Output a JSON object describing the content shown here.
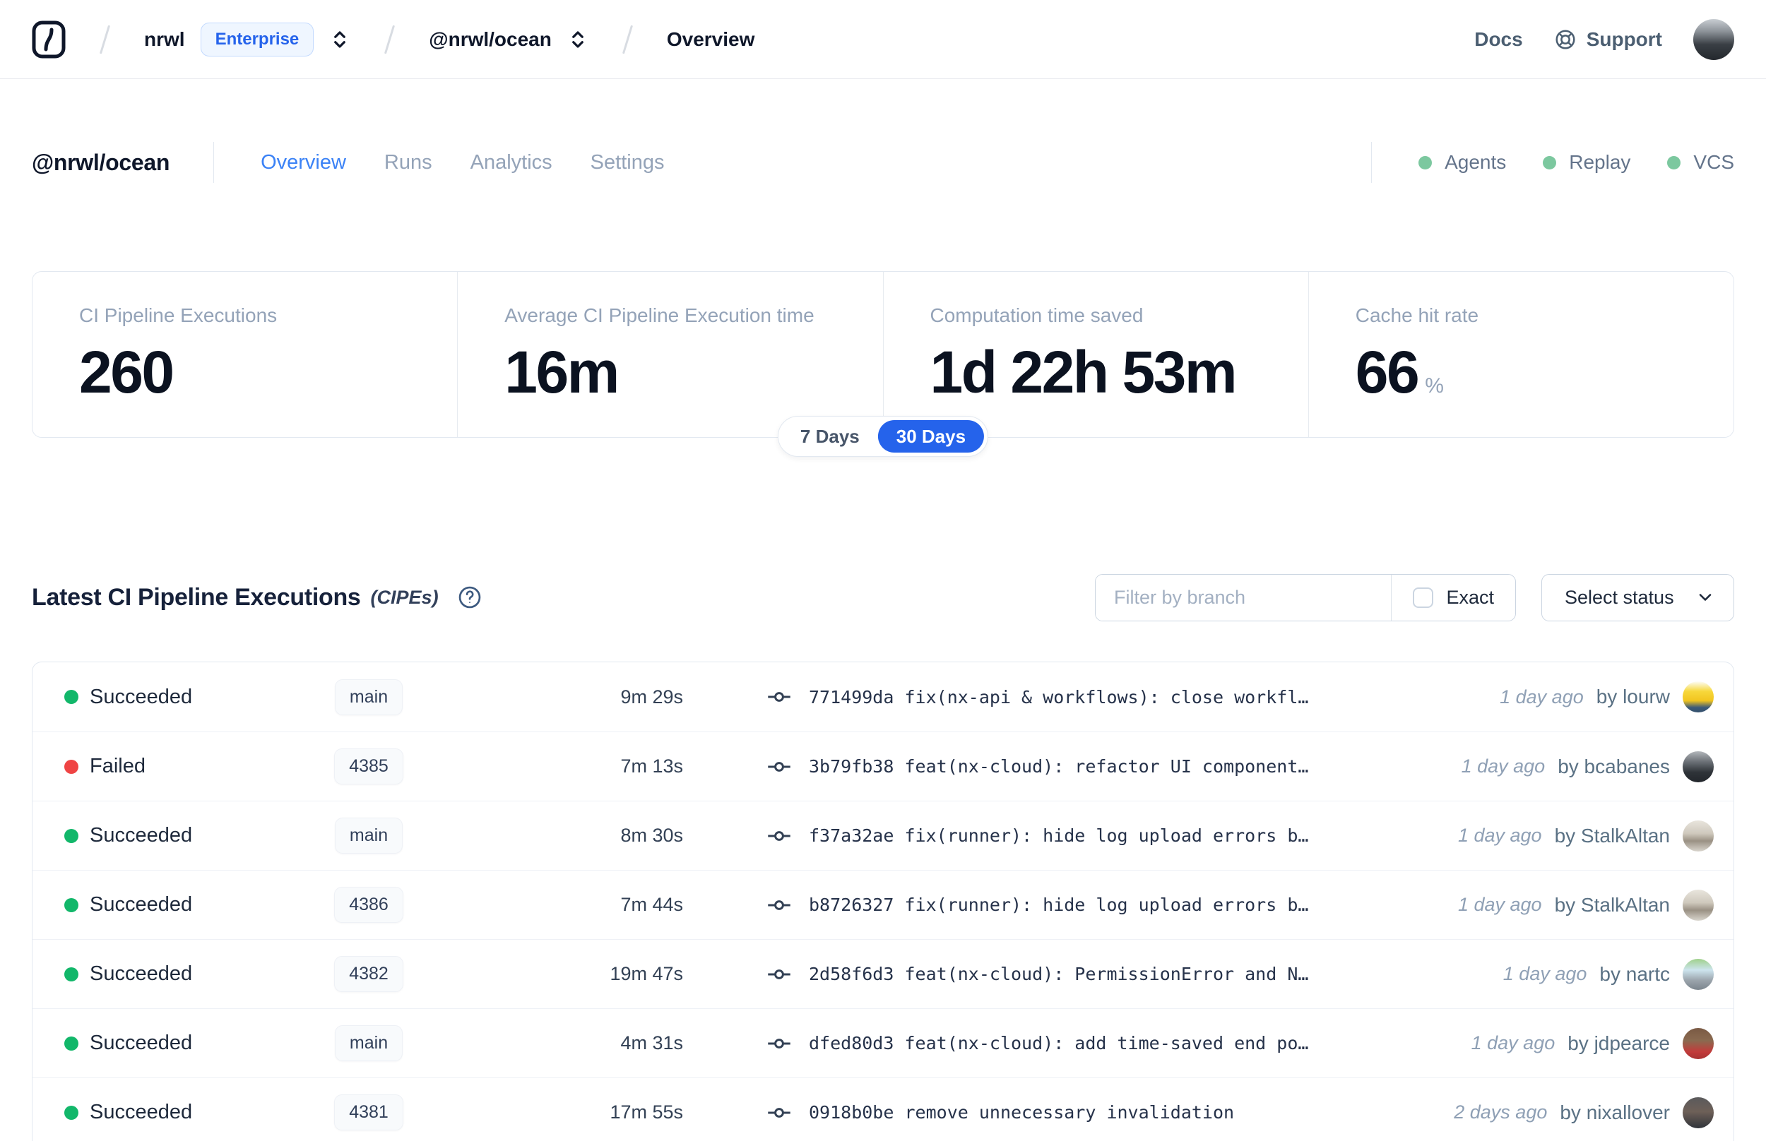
{
  "navbar": {
    "org": "nrwl",
    "plan_badge": "Enterprise",
    "workspace": "@nrwl/ocean",
    "page": "Overview",
    "docs": "Docs",
    "support": "Support",
    "user_avatar_bg": "linear-gradient(180deg,#c9ced3 0%,#8d9399 30%,#3a3f45 62%,#24282d 100%)"
  },
  "workspace_header": {
    "title": "@nrwl/ocean",
    "tabs": [
      {
        "label": "Overview"
      },
      {
        "label": "Runs"
      },
      {
        "label": "Analytics"
      },
      {
        "label": "Settings"
      }
    ],
    "indicators": [
      {
        "label": "Agents"
      },
      {
        "label": "Replay"
      },
      {
        "label": "VCS"
      }
    ],
    "indicator_dot_color": "#7cc89f"
  },
  "stats": {
    "cards": [
      {
        "label": "CI Pipeline Executions",
        "value": "260",
        "suffix": ""
      },
      {
        "label": "Average CI Pipeline Execution time",
        "value": "16m",
        "suffix": ""
      },
      {
        "label": "Computation time saved",
        "value": "1d 22h 53m",
        "suffix": ""
      },
      {
        "label": "Cache hit rate",
        "value": "66",
        "suffix": "%"
      }
    ],
    "toggle": {
      "options": [
        {
          "label": "7 Days",
          "active": false
        },
        {
          "label": "30 Days",
          "active": true
        }
      ]
    }
  },
  "cipes": {
    "title": "Latest CI Pipeline Executions",
    "suffix": "(CIPEs)",
    "filter_placeholder": "Filter by branch",
    "exact_label": "Exact",
    "status_select_label": "Select status",
    "rows": [
      {
        "status": "Succeeded",
        "status_color": "#12b76a",
        "branch": "main",
        "duration": "9m 29s",
        "commit": "771499da",
        "message": "fix(nx-api & workflows): close workfl…",
        "time": "1 day ago",
        "author": "by lourw",
        "avatar_bg": "linear-gradient(180deg,#fdfdf9 0%,#f7d83c 32%,#f2c51f 62%,#3c5a79 84%,#34506c 100%)"
      },
      {
        "status": "Failed",
        "status_color": "#ef4444",
        "branch": "4385",
        "duration": "7m 13s",
        "commit": "3b79fb38",
        "message": "feat(nx-cloud): refactor UI component…",
        "time": "1 day ago",
        "author": "by bcabanes",
        "avatar_bg": "linear-gradient(180deg,#b3b7bb 0%,#6b7076 34%,#2e3338 68%,#23272c 100%)"
      },
      {
        "status": "Succeeded",
        "status_color": "#12b76a",
        "branch": "main",
        "duration": "8m 30s",
        "commit": "f37a32ae",
        "message": "fix(runner): hide log upload errors b…",
        "time": "1 day ago",
        "author": "by StalkAltan",
        "avatar_bg": "linear-gradient(180deg,#e9e5dd 0%,#cfc9bd 42%,#9a9184 66%,#d9d5cd 100%)"
      },
      {
        "status": "Succeeded",
        "status_color": "#12b76a",
        "branch": "4386",
        "duration": "7m 44s",
        "commit": "b8726327",
        "message": "fix(runner): hide log upload errors b…",
        "time": "1 day ago",
        "author": "by StalkAltan",
        "avatar_bg": "linear-gradient(180deg,#e9e5dd 0%,#cfc9bd 42%,#9a9184 66%,#d9d5cd 100%)"
      },
      {
        "status": "Succeeded",
        "status_color": "#12b76a",
        "branch": "4382",
        "duration": "19m 47s",
        "commit": "2d58f6d3",
        "message": "feat(nx-cloud): PermissionError and N…",
        "time": "1 day ago",
        "author": "by nartc",
        "avatar_bg": "linear-gradient(180deg,#9fd08a 0%,#cde4ee 36%,#9aa3ab 70%,#7b858d 100%)"
      },
      {
        "status": "Succeeded",
        "status_color": "#12b76a",
        "branch": "main",
        "duration": "4m 31s",
        "commit": "dfed80d3",
        "message": "feat(nx-cloud): add time-saved end po…",
        "time": "1 day ago",
        "author": "by jdpearce",
        "avatar_bg": "linear-gradient(180deg,#7a5a44 0%,#8a6a50 40%,#c23b3b 76%,#a83232 100%)"
      },
      {
        "status": "Succeeded",
        "status_color": "#12b76a",
        "branch": "4381",
        "duration": "17m 55s",
        "commit": "0918b0be",
        "message": "remove unnecessary invalidation",
        "time": "2 days ago",
        "author": "by nixallover",
        "avatar_bg": "linear-gradient(180deg,#5a5a5c 0%,#6e6058 46%,#30343a 100%)"
      }
    ]
  }
}
